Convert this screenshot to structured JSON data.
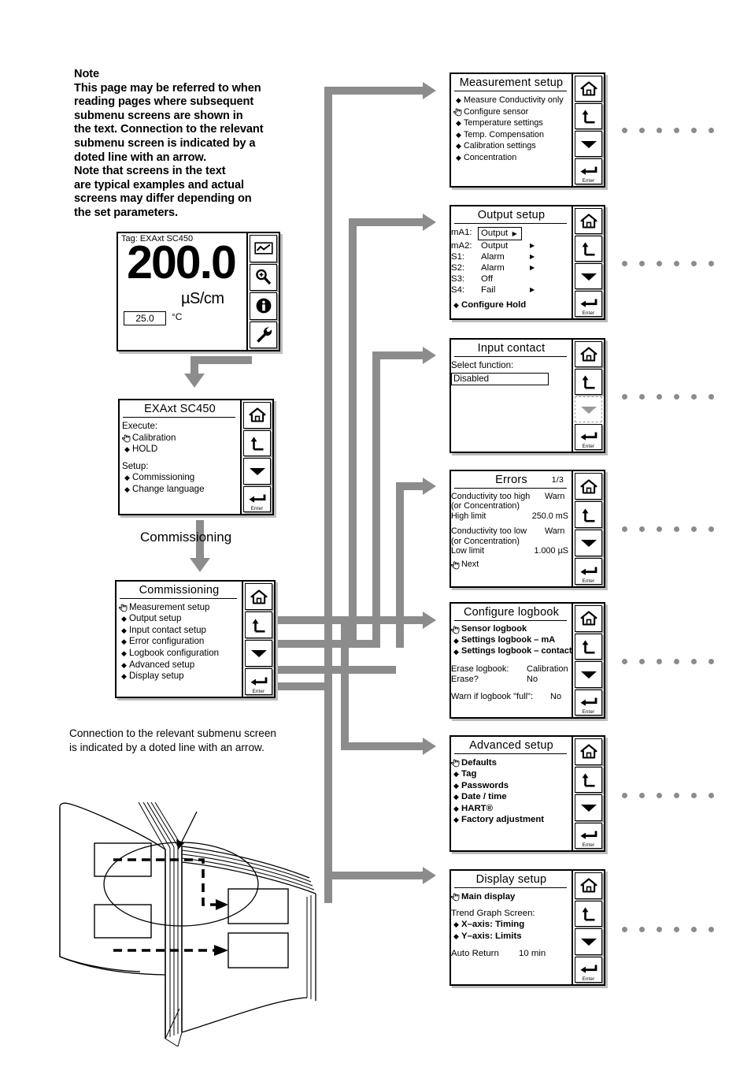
{
  "note": {
    "heading": "Note",
    "lines": [
      "This page may be referred to when",
      "reading pages where subsequent",
      "submenu screens are shown in",
      "the text. Connection to the relevant",
      "submenu screen is indicated by a",
      "doted line with an arrow.",
      "Note that screens in the text",
      "are typical examples and actual",
      "screens may differ depending on",
      "the set parameters."
    ]
  },
  "book_caption": {
    "lines": [
      "Connection to the relevant submenu screen",
      "is indicated by a doted line with an arrow."
    ]
  },
  "transition_label": "Commissioning",
  "main_display": {
    "tag": "Tag: EXAxt SC450",
    "value": "200.0",
    "unit": "µS/cm",
    "temperature": "25.0",
    "temperature_unit": "°C",
    "buttons": [
      "trend-graph-icon",
      "magnifier-zoom-icon",
      "info-icon",
      "wrench-icon"
    ]
  },
  "screens": {
    "top_menu": {
      "title": "EXAxt SC450",
      "sections": [
        {
          "header": "Execute:",
          "items": [
            {
              "marker": "hand",
              "label": "Calibration"
            },
            {
              "marker": "diamond",
              "label": "HOLD"
            }
          ]
        },
        {
          "header": "Setup:",
          "items": [
            {
              "marker": "diamond",
              "label": "Commissioning"
            },
            {
              "marker": "diamond",
              "label": "Change language"
            }
          ]
        }
      ],
      "buttons": [
        "home-icon",
        "return-icon",
        "down-arrow-icon",
        "enter-icon"
      ],
      "enter_caption": "Enter"
    },
    "commissioning": {
      "title": "Commissioning",
      "items": [
        {
          "marker": "hand",
          "label": "Measurement setup"
        },
        {
          "marker": "diamond",
          "label": "Output setup"
        },
        {
          "marker": "diamond",
          "label": "Input contact setup"
        },
        {
          "marker": "diamond",
          "label": "Error configuration"
        },
        {
          "marker": "diamond",
          "label": "Logbook configuration"
        },
        {
          "marker": "diamond",
          "label": "Advanced setup"
        },
        {
          "marker": "diamond",
          "label": "Display setup"
        }
      ],
      "buttons": [
        "home-icon",
        "return-icon",
        "down-arrow-icon",
        "enter-icon"
      ],
      "enter_caption": "Enter"
    },
    "measurement_setup": {
      "title": "Measurement setup",
      "items": [
        {
          "marker": "diamond",
          "label": "Measure Conductivity only"
        },
        {
          "marker": "hand",
          "label": "Configure sensor"
        },
        {
          "marker": "diamond",
          "label": "Temperature settings"
        },
        {
          "marker": "diamond",
          "label": "Temp. Compensation"
        },
        {
          "marker": "diamond",
          "label": "Calibration settings"
        },
        {
          "marker": "diamond",
          "label": "Concentration"
        }
      ],
      "enter_caption": "Enter"
    },
    "output_setup": {
      "title": "Output setup",
      "rows": [
        {
          "key": "mA1:",
          "value": "Output",
          "arrow": true,
          "selected": true
        },
        {
          "key": "mA2:",
          "value": "Output",
          "arrow": true,
          "selected": false
        },
        {
          "key": "S1:",
          "value": "Alarm",
          "arrow": true,
          "selected": false
        },
        {
          "key": "S2:",
          "value": "Alarm",
          "arrow": true,
          "selected": false
        },
        {
          "key": "S3:",
          "value": "Off",
          "arrow": false,
          "selected": false
        },
        {
          "key": "S4:",
          "value": "Fail",
          "arrow": true,
          "selected": false
        }
      ],
      "footer_item": {
        "marker": "diamond",
        "label": "Configure Hold"
      },
      "enter_caption": "Enter"
    },
    "input_contact": {
      "title": "Input contact",
      "field_label": "Select function:",
      "field_value": "Disabled",
      "enter_caption": "Enter"
    },
    "errors": {
      "title": "Errors",
      "page": "1/3",
      "entries": [
        {
          "name": "Conductivity too high",
          "state": "Warn",
          "sub": "(or Concentration)",
          "limit_label": "High limit",
          "limit_value": "250.0 mS"
        },
        {
          "name": "Conductivity too low",
          "state": "Warn",
          "sub": "(or Concentration)",
          "limit_label": "Low limit",
          "limit_value": "1.000 µS"
        }
      ],
      "next_label": "Next",
      "enter_caption": "Enter"
    },
    "configure_logbook": {
      "title": "Configure logbook",
      "items": [
        {
          "marker": "hand",
          "label": "Sensor logbook"
        },
        {
          "marker": "diamond",
          "label": "Settings logbook – mA"
        },
        {
          "marker": "diamond",
          "label": "Settings logbook – contact"
        }
      ],
      "erase_label": "Erase logbook:",
      "erase_value": "Calibration",
      "erase_q_label": "Erase?",
      "erase_q_value": "No",
      "warn_label": "Warn if logbook \"full\":",
      "warn_value": "No",
      "enter_caption": "Enter"
    },
    "advanced_setup": {
      "title": "Advanced setup",
      "items": [
        {
          "marker": "hand",
          "label": "Defaults"
        },
        {
          "marker": "diamond",
          "label": "Tag"
        },
        {
          "marker": "diamond",
          "label": "Passwords"
        },
        {
          "marker": "diamond",
          "label": "Date / time"
        },
        {
          "marker": "diamond",
          "label": "HART®"
        },
        {
          "marker": "diamond",
          "label": "Factory adjustment"
        }
      ],
      "enter_caption": "Enter"
    },
    "display_setup": {
      "title": "Display setup",
      "items": [
        {
          "marker": "hand",
          "label": "Main display"
        }
      ],
      "trend_header": "Trend Graph Screen:",
      "trend_items": [
        {
          "marker": "diamond",
          "label": "X–axis: Timing"
        },
        {
          "marker": "diamond",
          "label": "Y–axis: Limits"
        }
      ],
      "auto_return_label": "Auto Return",
      "auto_return_value": "10 min",
      "enter_caption": "Enter"
    }
  },
  "colors": {
    "connector_gray": "#8c8c8c",
    "shadow_gray": "#bdbdbd",
    "ink": "#000000"
  }
}
